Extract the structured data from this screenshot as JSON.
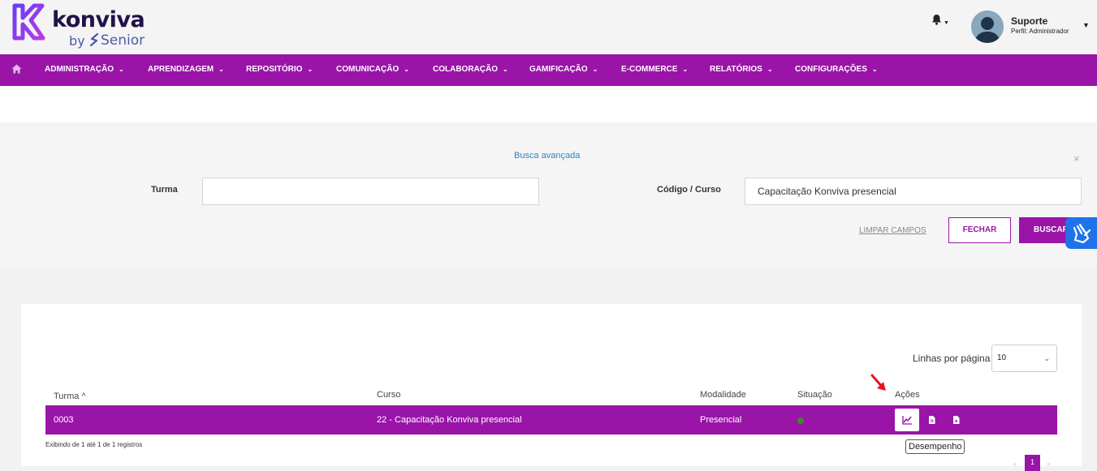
{
  "brand": {
    "name": "konviva",
    "by": "by",
    "partner": "Senior",
    "primary_color": "#9a14a8",
    "link_color": "#2a86c0"
  },
  "header": {
    "user_name": "Suporte",
    "user_role": "Perfil: Administrador",
    "notifications_icon": "bell-icon"
  },
  "nav": {
    "home_icon": "home-icon",
    "items": [
      {
        "label": "ADMINISTRAÇÃO"
      },
      {
        "label": "APRENDIZAGEM"
      },
      {
        "label": "REPOSITÓRIO"
      },
      {
        "label": "COMUNICAÇÃO"
      },
      {
        "label": "COLABORAÇÃO"
      },
      {
        "label": "GAMIFICAÇÃO"
      },
      {
        "label": "E-COMMERCE"
      },
      {
        "label": "RELATÓRIOS"
      },
      {
        "label": "CONFIGURAÇÕES"
      }
    ]
  },
  "search": {
    "title": "Busca avançada",
    "close_symbol": "×",
    "turma_label": "Turma",
    "turma_value": "",
    "codigo_label": "Código / Curso",
    "codigo_value": "Capacitação Konviva presencial",
    "clear_label": "LIMPAR CAMPOS",
    "close_label": "FECHAR",
    "search_label": "BUSCAR"
  },
  "results": {
    "rows_per_page_label": "Linhas por página",
    "rows_per_page_value": "10",
    "columns": {
      "turma": "Turma",
      "curso": "Curso",
      "modalidade": "Modalidade",
      "situacao": "Situação",
      "acoes": "Ações"
    },
    "sort_indicator": "^",
    "rows": [
      {
        "turma": "0003",
        "curso": "22 - Capacitação Konviva presencial",
        "modalidade": "Presencial",
        "situacao_color": "#3e8a2a"
      }
    ],
    "tooltip": "Desempenho",
    "showing": "Exibindo de 1 até 1 de 1 registros",
    "current_page": "1",
    "prev_symbol": "«",
    "next_symbol": "»"
  }
}
